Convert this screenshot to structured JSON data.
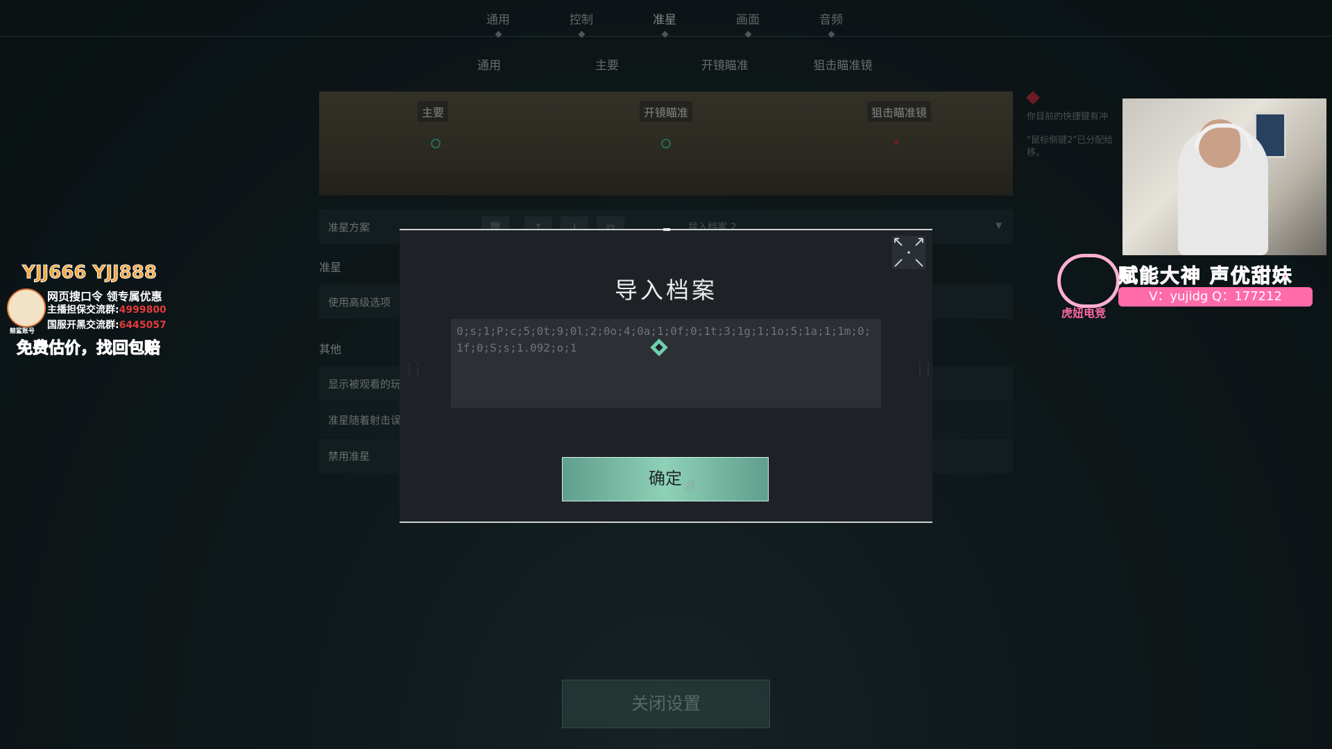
{
  "top_tabs": [
    "通用",
    "控制",
    "准星",
    "画面",
    "音频"
  ],
  "active_tab": "准星",
  "sub_tabs": [
    "通用",
    "主要",
    "开镜瞄准",
    "狙击瞄准镜"
  ],
  "preview": {
    "labels": [
      "主要",
      "开镜瞄准",
      "狙击瞄准镜"
    ]
  },
  "settings": {
    "profile_label": "准星方案",
    "profile_dropdown": "导入档案 2",
    "section_crosshair": "准星",
    "advanced_options": "使用高级选项",
    "section_other": "其他",
    "show_spectated": "显示被观看的玩",
    "follow_spray": "准星随着射击误",
    "disable_crosshair": "禁用准星"
  },
  "modal": {
    "title": "导入档案",
    "code_value": "0;s;1;P;c;5;0t;9;0l;2;0o;4;0a;1;0f;0;1t;3;1g;1;1o;5;1a;1;1m;0;1f;0;S;s;1.092;o;1",
    "confirm_label": "确定"
  },
  "close_settings_label": "关闭设置",
  "warning": {
    "text1": "你目前的快捷键有冲",
    "text2": "\"鼠标侧键2\"已分配给",
    "text3": "移。"
  },
  "overlay_right": {
    "name": "赋能大神 声优甜妹",
    "contact": "V：yujidg Q：177212",
    "brand": "虎妞电竞"
  },
  "overlay_left": {
    "line1": "YJJ666 YJJ888",
    "line2": "网页搜口令 领专属优惠",
    "line3_label": "主播担保交流群:",
    "line3_num": "4999800",
    "line4_label": "国服开黑交流群:",
    "line4_num": "6445057",
    "line5": "免费估价，找回包赔",
    "logo_text": "鲸鲨账号"
  },
  "colors": {
    "accent": "#8fd0b8",
    "warning": "#c12a3a",
    "modal_bg": "#1e2226"
  }
}
